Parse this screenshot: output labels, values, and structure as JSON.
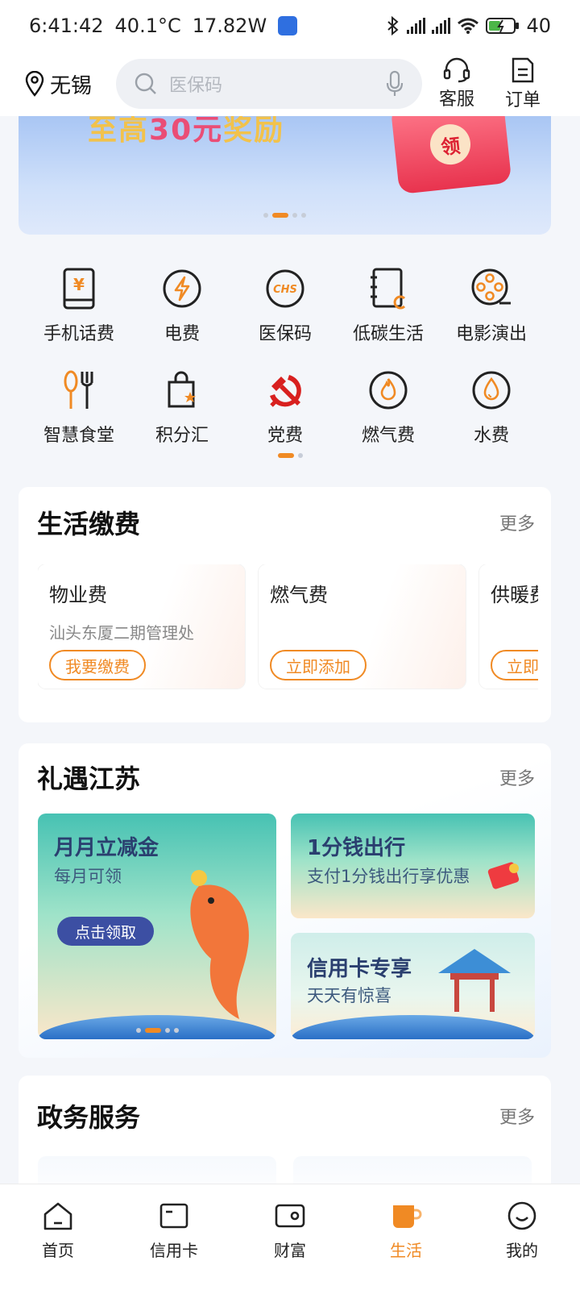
{
  "status": {
    "time": "6:41:42",
    "temp": "40.1°C",
    "power": "17.82W",
    "battery": "40"
  },
  "header": {
    "location": "无锡",
    "search_placeholder": "医保码",
    "service_label": "客服",
    "orders_label": "订单"
  },
  "banner": {
    "title_lead": "至高",
    "title_amount": "30元",
    "title_tail": "奖励",
    "coin_text": "领"
  },
  "grid": [
    {
      "label": "手机话费",
      "icon": "phone-bill-icon"
    },
    {
      "label": "电费",
      "icon": "lightning-icon"
    },
    {
      "label": "医保码",
      "icon": "chs-icon",
      "badge": "CHS"
    },
    {
      "label": "低碳生活",
      "icon": "notebook-icon"
    },
    {
      "label": "电影演出",
      "icon": "film-reel-icon"
    },
    {
      "label": "智慧食堂",
      "icon": "cutlery-icon"
    },
    {
      "label": "积分汇",
      "icon": "shopping-bag-icon"
    },
    {
      "label": "党费",
      "icon": "party-emblem-icon"
    },
    {
      "label": "燃气费",
      "icon": "flame-icon"
    },
    {
      "label": "水费",
      "icon": "water-drop-icon"
    }
  ],
  "life_pay": {
    "title": "生活缴费",
    "more": "更多",
    "items": [
      {
        "name": "物业费",
        "sub": "汕头东厦二期管理处",
        "button": "我要缴费"
      },
      {
        "name": "燃气费",
        "sub": "",
        "button": "立即添加"
      },
      {
        "name": "供暖费",
        "sub": "",
        "button": "立即添加"
      }
    ]
  },
  "promo": {
    "title": "礼遇江苏",
    "more": "更多",
    "main_tile": {
      "title": "月月立减金",
      "sub": "每月可领",
      "button": "点击领取"
    },
    "tile_travel": {
      "title": "1分钱出行",
      "sub": "支付1分钱出行享优惠"
    },
    "tile_credit": {
      "title": "信用卡专享",
      "sub": "天天有惊喜"
    }
  },
  "gov": {
    "title": "政务服务",
    "more": "更多"
  },
  "tabs": [
    {
      "label": "首页",
      "icon": "home-icon"
    },
    {
      "label": "信用卡",
      "icon": "credit-card-icon"
    },
    {
      "label": "财富",
      "icon": "wallet-icon"
    },
    {
      "label": "生活",
      "icon": "cup-icon",
      "active": true
    },
    {
      "label": "我的",
      "icon": "smiley-icon"
    }
  ],
  "colors": {
    "accent": "#f08a24",
    "text": "#222222",
    "muted": "#888888",
    "party_red": "#d8201f"
  }
}
